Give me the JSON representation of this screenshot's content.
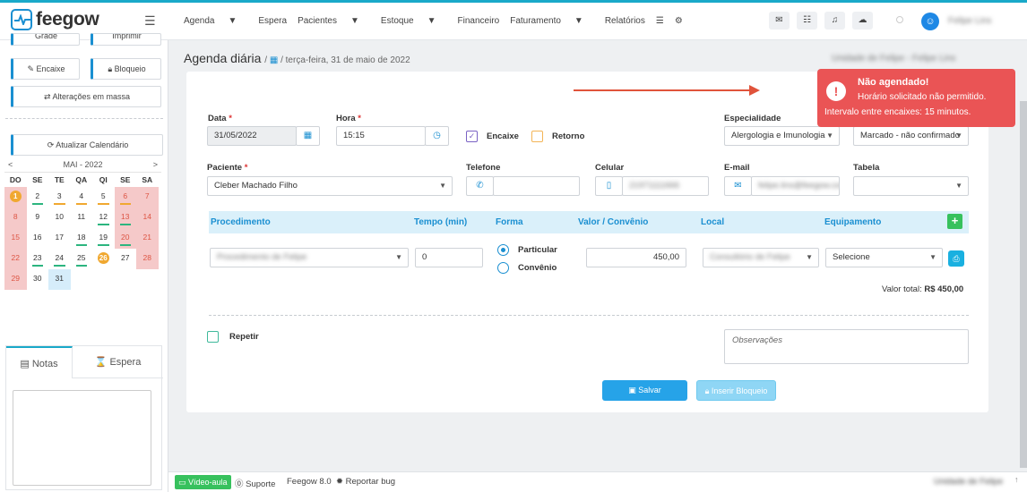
{
  "app": {
    "logo_text": "feegow",
    "nav": [
      {
        "label": "Agenda",
        "dropdown": true
      },
      {
        "label": "Espera",
        "dropdown": false
      },
      {
        "label": "Pacientes",
        "dropdown": true
      },
      {
        "label": "Estoque",
        "dropdown": true
      },
      {
        "label": "Financeiro",
        "dropdown": false
      },
      {
        "label": "Faturamento",
        "dropdown": true
      },
      {
        "label": "Relatórios",
        "dropdown": false
      }
    ],
    "nav_extra_icons": [
      "database-icon",
      "gear-icon"
    ],
    "header_icons": [
      "inbox-icon",
      "checklist-icon",
      "bell-icon",
      "chat-icon"
    ],
    "user_name": "Felipe Lins",
    "accent": "#1a8fd1"
  },
  "sidebar": {
    "top_buttons": [
      "Grade",
      "Imprimir"
    ],
    "encaixe_label": "Encaixe",
    "bloqueio_label": "Bloqueio",
    "massa_label": "Alterações em massa",
    "refresh_label": "Atualizar Calendário",
    "calendar": {
      "month_label": "MAI - 2022",
      "prev": "<",
      "next": ">",
      "dow": [
        "DO",
        "SE",
        "TE",
        "QA",
        "QI",
        "SE",
        "SA"
      ]
    },
    "tabs": {
      "notas": "Notas",
      "espera": "Espera"
    }
  },
  "page": {
    "title": "Agenda diária",
    "breadcrumb_sep": "/",
    "date_text": "terça-feira, 31 de maio de 2022",
    "unit_name": "Unidade de Felipe - Felipe Lins"
  },
  "form": {
    "data_label": "Data",
    "data_value": "31/05/2022",
    "hora_label": "Hora",
    "hora_value": "15:15",
    "encaixe_label": "Encaixe",
    "retorno_label": "Retorno",
    "especialidade_label": "Especialidade",
    "especialidade_value": "Alergologia e Imunologia",
    "status_value": "Marcado - não confirmado",
    "paciente_label": "Paciente",
    "paciente_value": "Cleber Machado Filho",
    "telefone_label": "Telefone",
    "celular_label": "Celular",
    "celular_value": "21971111666",
    "email_label": "E-mail",
    "email_value": "felipe.lins@feegow.com",
    "tabela_label": "Tabela",
    "required_mark": "*",
    "proc_headers": {
      "procedimento": "Procedimento",
      "tempo": "Tempo (min)",
      "forma": "Forma",
      "valor": "Valor / Convênio",
      "local": "Local",
      "equipamento": "Equipamento"
    },
    "proc_row": {
      "procedimento": "Procedimento de Felipe",
      "tempo": "0",
      "forma_particular": "Particular",
      "forma_convenio": "Convênio",
      "valor": "450,00",
      "local": "Consultório de Felipe",
      "equipamento": "Selecione"
    },
    "valor_total_label": "Valor total:",
    "valor_total_value": "R$ 450,00",
    "repetir_label": "Repetir",
    "obs_placeholder": "Observações",
    "save_label": "Salvar",
    "block_label": "Inserir Bloqueio"
  },
  "toast": {
    "title": "Não agendado!",
    "line1": "Horário solicitado não permitido.",
    "line2": "Intervalo entre encaixes: 15 minutos.",
    "color": "#ea5455"
  },
  "footer": {
    "video": "Vídeo-aula",
    "suporte": "Suporte",
    "version": "Feegow 8.0",
    "bug": "Reportar bug",
    "right_text": "Unidade de Felipe"
  }
}
